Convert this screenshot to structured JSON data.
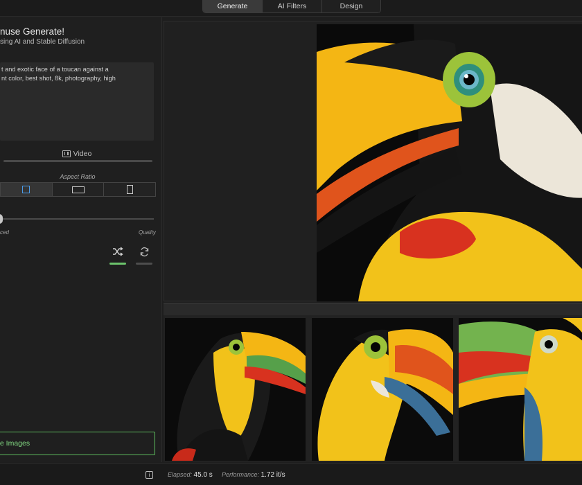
{
  "tabs": [
    {
      "label": "Generate",
      "active": true
    },
    {
      "label": "AI Filters",
      "active": false
    },
    {
      "label": "Design",
      "active": false
    }
  ],
  "sidebar": {
    "title": "nuse Generate!",
    "subtitle": "sing AI and Stable Diffusion",
    "prompt": "t and exotic face of a toucan against a\nnt color, best shot, 8k, photography, high",
    "video_label": "Video",
    "aspect_label": "Aspect Ratio",
    "aspect_options": [
      "square",
      "landscape",
      "portrait"
    ],
    "aspect_selected": "square",
    "slider_left_label": "ced",
    "slider_right_label": "Quality",
    "generate_button": "te Images"
  },
  "status": {
    "elapsed_label": "Elapsed:",
    "elapsed_value": "45.0 s",
    "performance_label": "Performance:",
    "performance_value": "1.72 it/s"
  },
  "colors": {
    "accent_green": "#5dbb5d",
    "accent_blue": "#4a9be8",
    "background": "#1e1e1e"
  },
  "icons": {
    "video": "film-icon",
    "shuffle": "shuffle-icon",
    "refresh": "refresh-icon",
    "info": "info-icon"
  }
}
